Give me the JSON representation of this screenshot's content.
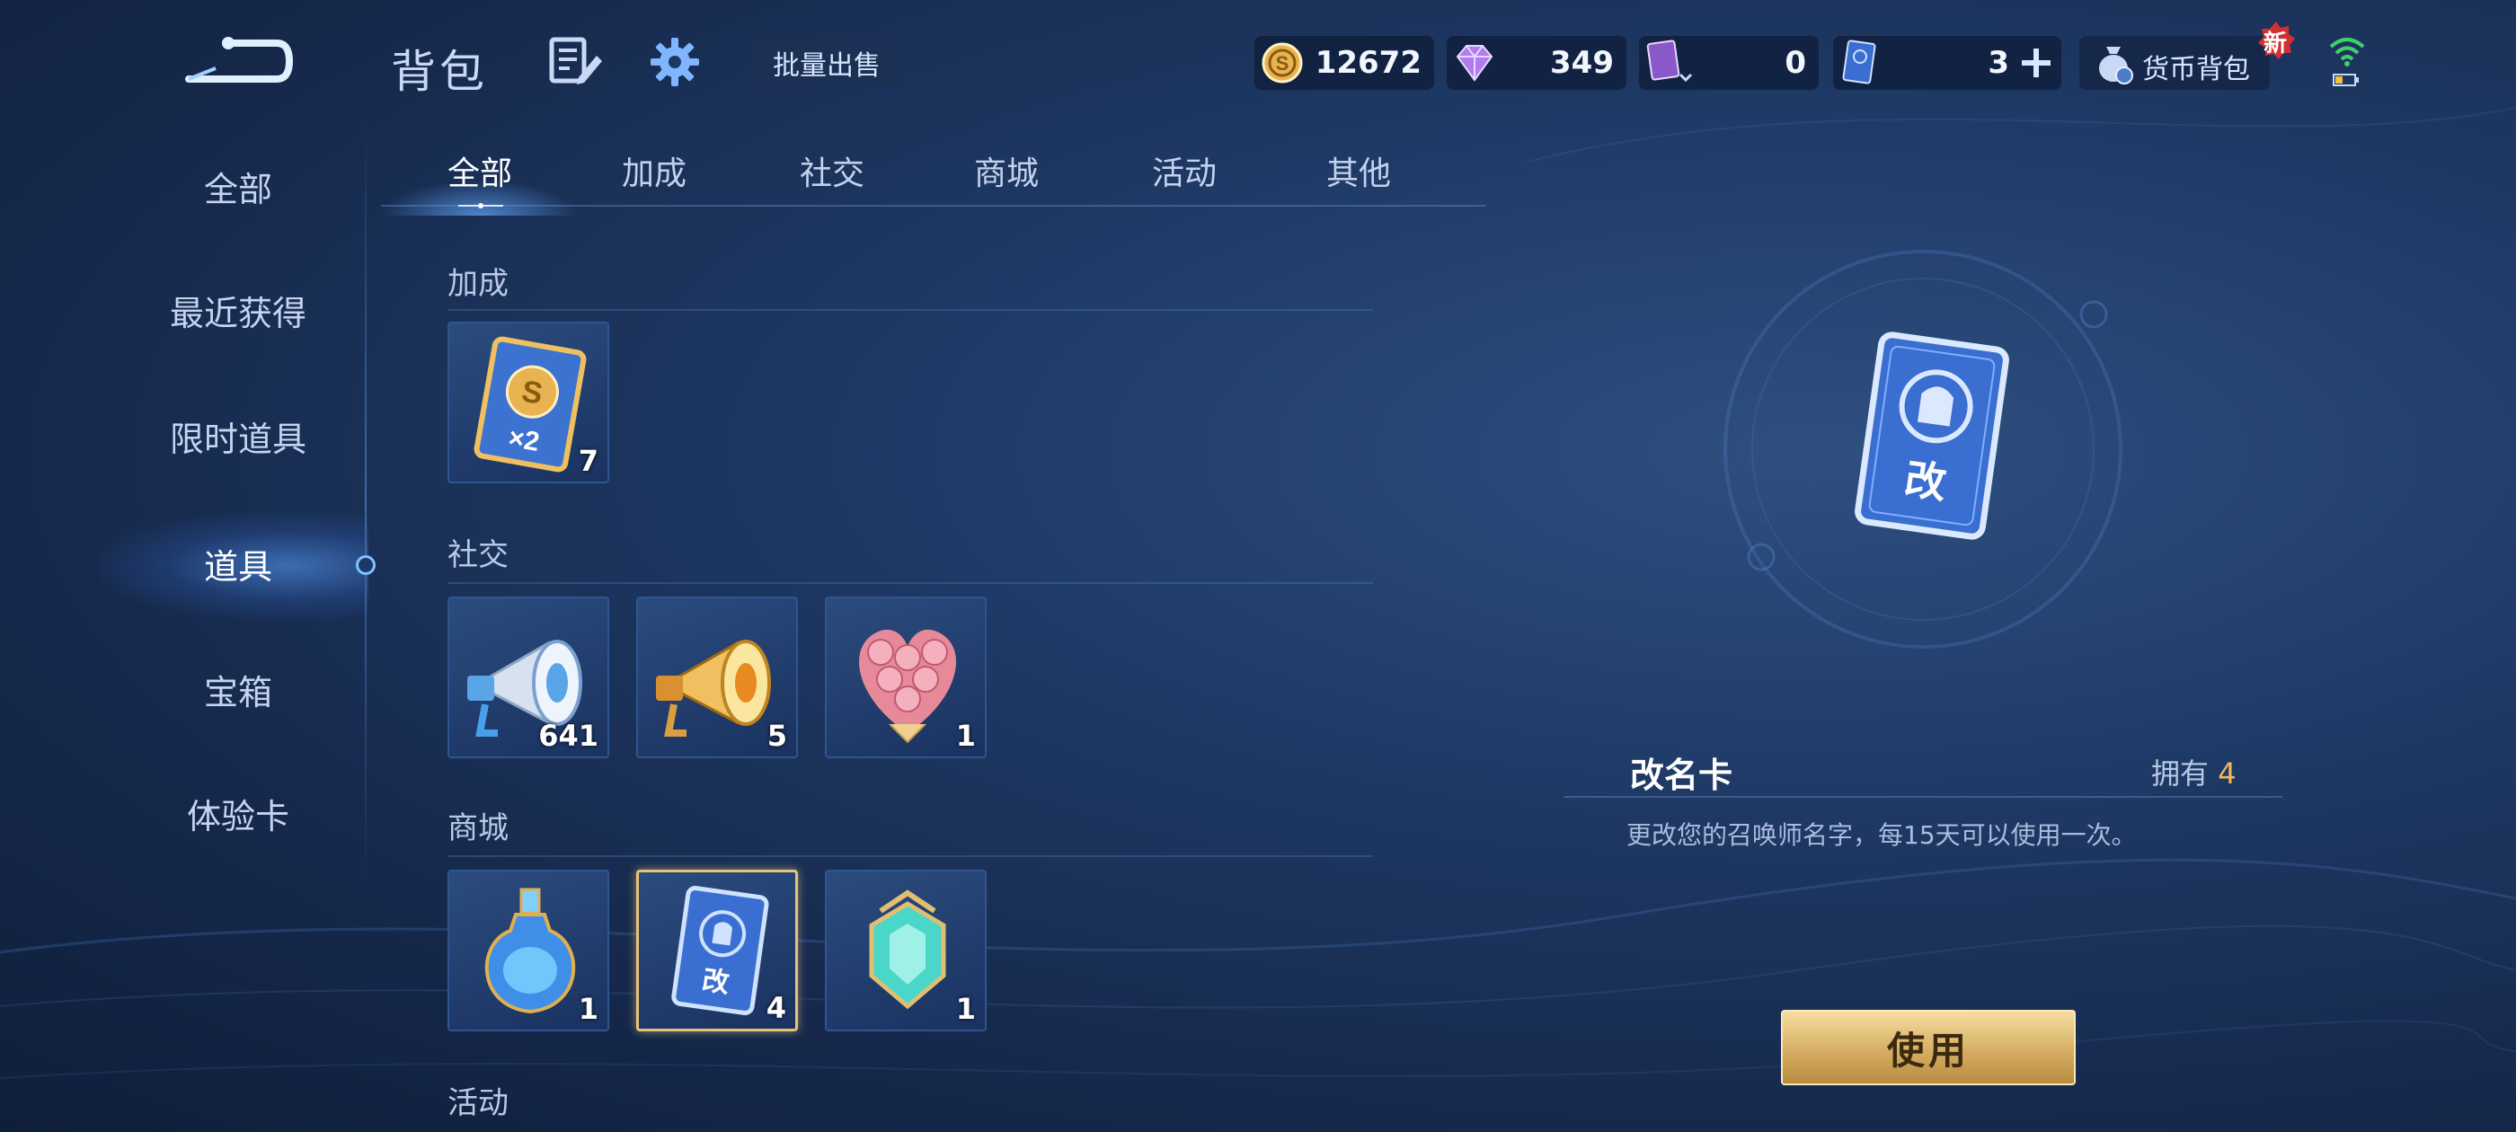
{
  "header": {
    "title": "背包",
    "batch_sell_label": "批量出售",
    "resources": {
      "gold": "12672",
      "gems": "349",
      "cards": "0",
      "rename_cards": "3"
    },
    "wallet_label": "货币背包",
    "new_badge": "新"
  },
  "sidebar": {
    "items": [
      {
        "label": "全部"
      },
      {
        "label": "最近获得"
      },
      {
        "label": "限时道具"
      },
      {
        "label": "道具"
      },
      {
        "label": "宝箱"
      },
      {
        "label": "体验卡"
      }
    ],
    "active_index": 3
  },
  "tabs": [
    {
      "label": "全部"
    },
    {
      "label": "加成"
    },
    {
      "label": "社交"
    },
    {
      "label": "商城"
    },
    {
      "label": "活动"
    },
    {
      "label": "其他"
    }
  ],
  "sections": {
    "bonus": {
      "title": "加成",
      "items": [
        {
          "name": "gold-double-card",
          "count": "7"
        }
      ]
    },
    "social": {
      "title": "社交",
      "items": [
        {
          "name": "silver-megaphone",
          "count": "641"
        },
        {
          "name": "gold-megaphone",
          "count": "5"
        },
        {
          "name": "rose-bouquet",
          "count": "1"
        }
      ]
    },
    "shop": {
      "title": "商城",
      "items": [
        {
          "name": "potion-bottle",
          "count": "1"
        },
        {
          "name": "rename-card",
          "count": "4"
        },
        {
          "name": "crystal-gem",
          "count": "1"
        }
      ]
    },
    "activity": {
      "title": "活动"
    }
  },
  "detail": {
    "name": "改名卡",
    "own_label": "拥有",
    "own_count": "4",
    "description": "更改您的召唤师名字，每15天可以使用一次。",
    "use_label": "使用",
    "card_char": "改"
  },
  "icons": {
    "back": "back-arrow-icon",
    "edit": "edit-list-icon",
    "settings": "gear-icon",
    "gold": "gold-coin-icon",
    "gem": "purple-gem-icon",
    "card": "purple-card-icon",
    "rename": "rename-card-icon",
    "add": "plus-icon",
    "wallet": "money-bag-icon",
    "wifi": "wifi-icon",
    "battery": "battery-icon"
  },
  "colors": {
    "accent_gold": "#e6c37a",
    "own_count": "#f0b85a",
    "active_glow": "#5aa0ff"
  }
}
